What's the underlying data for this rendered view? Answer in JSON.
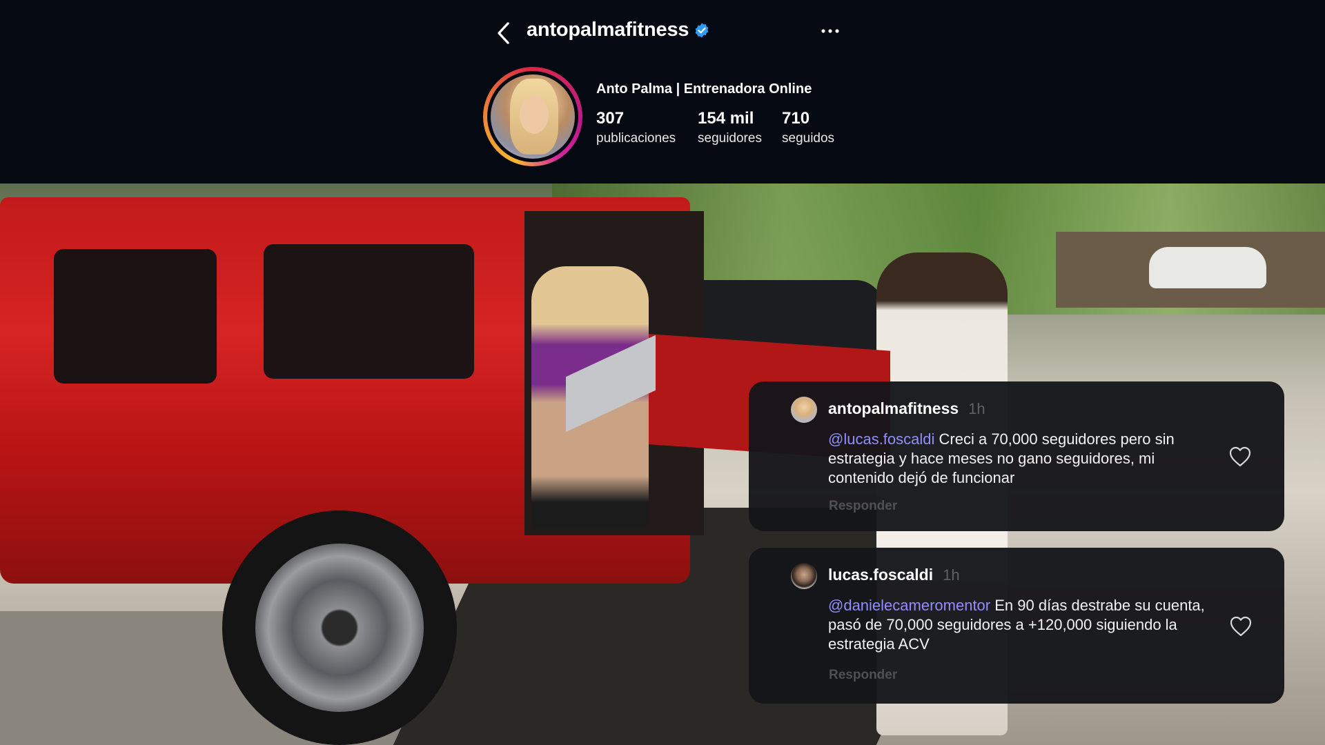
{
  "profile": {
    "username": "antopalmafitness",
    "full_name": "Anto Palma | Entrenadora Online",
    "stats": [
      {
        "value": "307",
        "label": "publicaciones"
      },
      {
        "value": "154 mil",
        "label": "seguidores"
      },
      {
        "value": "710",
        "label": "seguidos"
      }
    ]
  },
  "comments": [
    {
      "username": "antopalmafitness",
      "time": "1h",
      "mention": "@lucas.foscaldi",
      "text": " Creci a 70,000 seguidores pero sin estrategia y hace meses no gano seguidores, mi contenido dejó de funcionar",
      "reply_label": "Responder"
    },
    {
      "username": "lucas.foscaldi",
      "time": "1h",
      "mention": "@danielecameromentor",
      "text": "  En 90 días destrabe su cuenta, pasó de 70,000 seguidores a +120,000 siguiendo la estrategia ACV",
      "reply_label": "Responder"
    }
  ],
  "icons": {
    "back": "chevron-left-icon",
    "verified": "verified-badge-icon",
    "more": "more-horizontal-icon",
    "like": "heart-outline-icon"
  },
  "colors": {
    "header_bg": "#050912",
    "verified_blue": "#2f9bf7",
    "mention": "#8f8fff",
    "card_bg": "#15161a"
  }
}
